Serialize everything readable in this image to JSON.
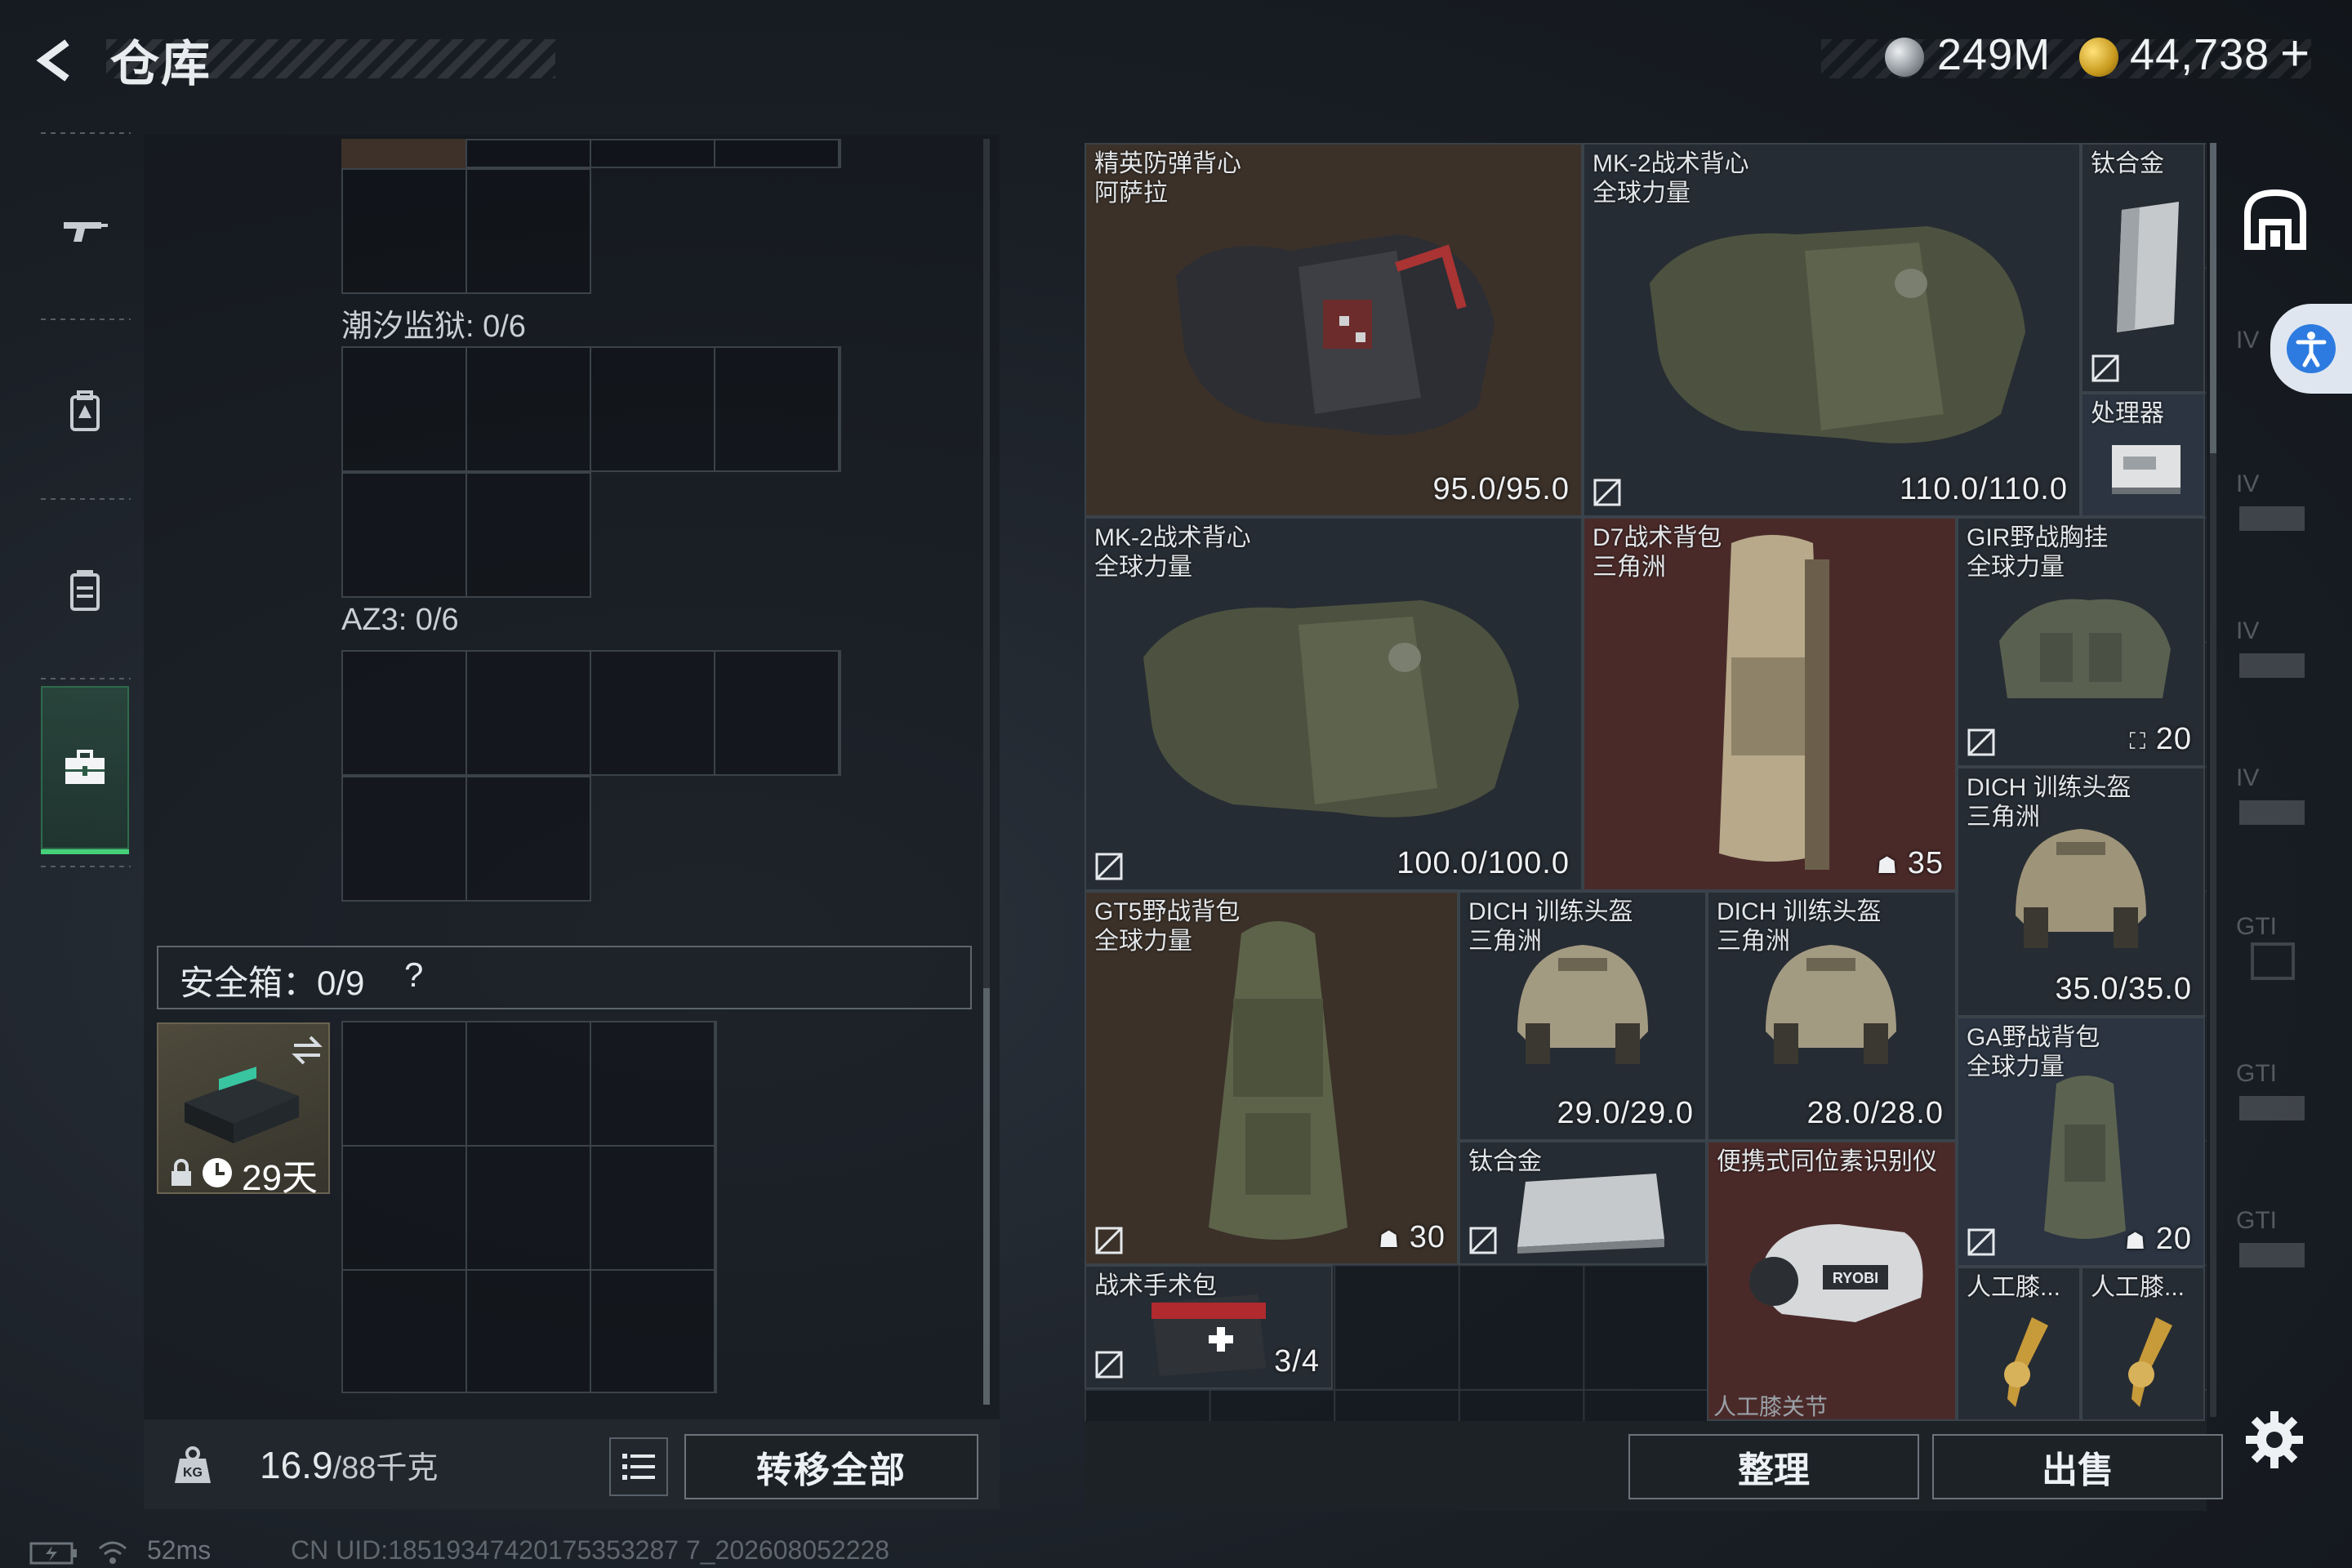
{
  "header": {
    "title": "仓库",
    "currency_silver": "249M",
    "currency_gold": "44,738",
    "plus_label": "+"
  },
  "left_nav": {
    "items": [
      "weapon-icon",
      "backpack-icon",
      "chest-rig-icon",
      "toolbox-icon"
    ],
    "selected": "toolbox-icon"
  },
  "containers": [
    {
      "label": "潮汐监狱: 0/6"
    },
    {
      "label": "AZ3: 0/6"
    }
  ],
  "safebox": {
    "label": "安全箱：0/9",
    "help": "?",
    "timer": "29天"
  },
  "weight": {
    "current": "16.9",
    "max_unit": "/88千克"
  },
  "buttons": {
    "transfer_all": "转移全部",
    "sort": "整理",
    "sell": "出售"
  },
  "status": {
    "ping": "52ms",
    "uid": "CN UID:18519347420175353287 7_202608052228"
  },
  "inventory": [
    {
      "name1": "精英防弹背心",
      "name2": "阿萨拉",
      "value": "95.0/95.0"
    },
    {
      "name1": "MK-2战术背心",
      "name2": "全球力量",
      "value": "110.0/110.0"
    },
    {
      "name1": "钛合金",
      "name2": "",
      "value": ""
    },
    {
      "name1": "处理器",
      "name2": "",
      "value": ""
    },
    {
      "name1": "MK-2战术背心",
      "name2": "全球力量",
      "value": "100.0/100.0"
    },
    {
      "name1": "D7战术背包",
      "name2": "三角洲",
      "value": "35"
    },
    {
      "name1": "GIR野战胸挂",
      "name2": "全球力量",
      "value": "20"
    },
    {
      "name1": "DICH 训练头盔",
      "name2": "三角洲",
      "value": "35.0/35.0"
    },
    {
      "name1": "GT5野战背包",
      "name2": "全球力量",
      "value": "30"
    },
    {
      "name1": "DICH 训练头盔",
      "name2": "三角洲",
      "value": "29.0/29.0"
    },
    {
      "name1": "DICH 训练头盔",
      "name2": "三角洲",
      "value": "28.0/28.0"
    },
    {
      "name1": "GA野战背包",
      "name2": "全球力量",
      "value": "20"
    },
    {
      "name1": "钛合金",
      "name2": "",
      "value": ""
    },
    {
      "name1": "便携式同位素识别仪",
      "name2": "",
      "value": ""
    },
    {
      "name1": "战术手术包",
      "name2": "",
      "value": "3/4"
    },
    {
      "name1": "人工膝...",
      "name2": "",
      "value": ""
    },
    {
      "name1": "人工膝...",
      "name2": "",
      "value": ""
    },
    {
      "name1": "人工膝关节",
      "name2": "",
      "value": ""
    }
  ],
  "right_column": {
    "tier_labels": [
      "IV",
      "IV",
      "IV",
      "IV",
      "GTI",
      "GTI",
      "GTI"
    ]
  },
  "colors": {
    "accent_green": "#45d17a",
    "brown_tile": "#3b3129",
    "red_tile": "#4a2a29"
  }
}
